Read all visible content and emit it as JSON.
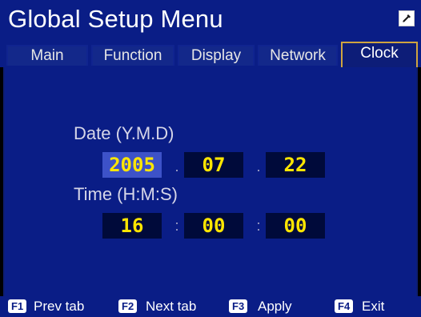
{
  "window": {
    "title": "Global Setup Menu"
  },
  "tabs": [
    {
      "label": "Main"
    },
    {
      "label": "Function"
    },
    {
      "label": "Display"
    },
    {
      "label": "Network"
    },
    {
      "label": "Clock",
      "active": true
    }
  ],
  "date": {
    "label": "Date (Y.M.D)",
    "year": "2005",
    "month": "07",
    "day": "22",
    "separator": "."
  },
  "time": {
    "label": "Time (H:M:S)",
    "hour": "16",
    "minute": "00",
    "second": "00",
    "separator": ":"
  },
  "footer": {
    "f1_key": "F1",
    "f1_label": "Prev tab",
    "f2_key": "F2",
    "f2_label": "Next tab",
    "f3_key": "F3",
    "f3_label": "Apply",
    "f4_key": "F4",
    "f4_label": "Exit"
  },
  "colors": {
    "background": "#0a1d86",
    "value_text": "#ffe600",
    "selected_field": "#3d52c8",
    "active_tab_border": "#cfa43f"
  },
  "icons": {
    "corner": "edit-icon"
  }
}
